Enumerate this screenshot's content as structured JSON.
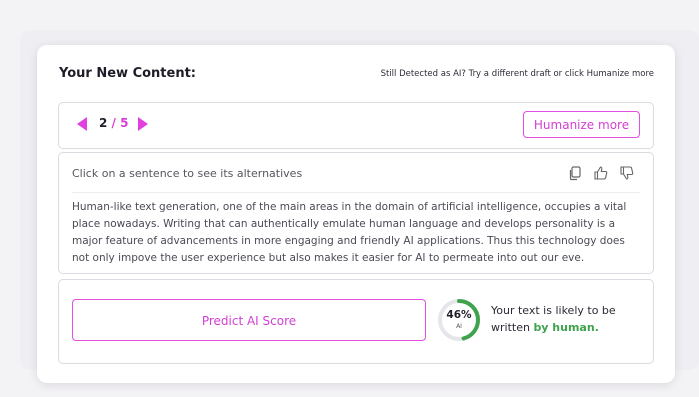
{
  "header": {
    "title": "Your New Content:",
    "note": "Still Detected as AI? Try a different draft or click Humanize more"
  },
  "navigator": {
    "current": "2",
    "separator": "/",
    "total": "5",
    "humanize_label": "Humanize more"
  },
  "content": {
    "hint": "Click on a sentence to see its alternatives",
    "icons": [
      "copy-icon",
      "thumbs-up-icon",
      "thumbs-down-icon"
    ],
    "text": "Human-like text generation, one of the main areas in the domain of artificial intelligence, occupies a vital place nowadays. Writing that can authentically emulate human language and develops personality is a major feature of advancements in more engaging and friendly AI applications. Thus this technology does not only impove the user experience but also makes it easier for AI to permeate into out our eve."
  },
  "score": {
    "predict_label": "Predict AI Score",
    "percent_value": 46,
    "percent_text": "46%",
    "ai_label": "AI",
    "verdict_prefix": "Your text is likely to be written ",
    "verdict_highlight": "by human.",
    "colors": {
      "gauge": "#3fa34d",
      "track": "#e6e6ea",
      "accent": "#e040e0"
    }
  }
}
